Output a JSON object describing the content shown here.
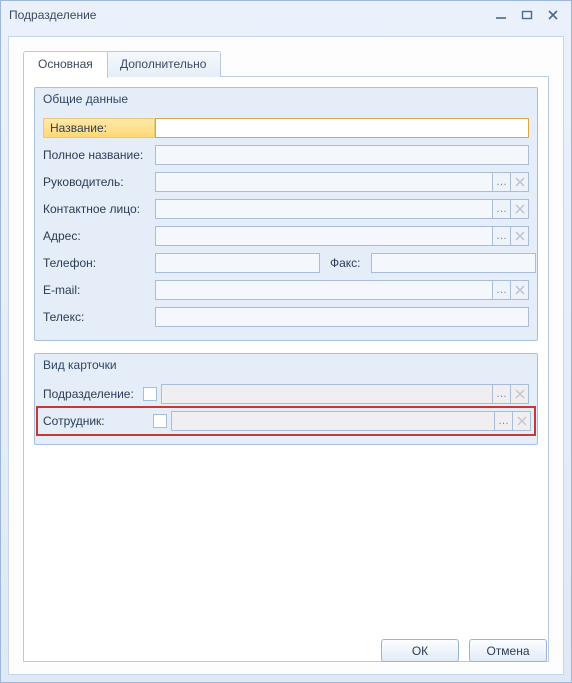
{
  "window": {
    "title": "Подразделение"
  },
  "tabs": {
    "main": "Основная",
    "extra": "Дополнительно"
  },
  "group1": {
    "title": "Общие данные",
    "fields": {
      "name_label": "Название:",
      "fullname_label": "Полное название:",
      "head_label": "Руководитель:",
      "contact_label": "Контактное лицо:",
      "address_label": "Адрес:",
      "phone_label": "Телефон:",
      "fax_label": "Факс:",
      "email_label": "E-mail:",
      "telex_label": "Телекс:",
      "name_value": "",
      "fullname_value": "",
      "head_value": "",
      "contact_value": "",
      "address_value": "",
      "phone_value": "",
      "fax_value": "",
      "email_value": "",
      "telex_value": ""
    }
  },
  "group2": {
    "title": "Вид карточки",
    "fields": {
      "dept_label": "Подразделение:",
      "emp_label": "Сотрудник:",
      "dept_value": "",
      "emp_value": ""
    }
  },
  "buttons": {
    "ok": "ОК",
    "cancel": "Отмена"
  },
  "icons": {
    "ellipsis": "…"
  }
}
